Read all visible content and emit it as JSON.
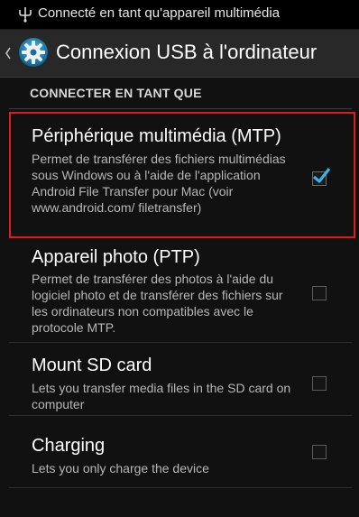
{
  "status_bar": {
    "icon": "usb-icon",
    "text": "Connecté en tant qu'appareil multimédia"
  },
  "action_bar": {
    "up_icon": "chevron-left-icon",
    "app_icon": "settings-gear-icon",
    "title": "Connexion USB à l'ordinateur"
  },
  "section": {
    "header": "CONNECTER EN TANT QUE"
  },
  "options": [
    {
      "title": "Périphérique multimédia (MTP)",
      "summary": "Permet de transférer des fichiers multimédias sous Windows ou à l'aide de l'application Android File Transfer pour Mac (voir www.android.com/ filetransfer)",
      "checked": true
    },
    {
      "title": "Appareil photo (PTP)",
      "summary": "Permet de transférer des photos à l'aide du logiciel photo et de transférer des fichiers sur les ordinateurs non compatibles avec le protocole MTP.",
      "checked": false
    },
    {
      "title": "Mount SD card",
      "summary": "Lets you transfer media files in the SD card on computer",
      "checked": false
    },
    {
      "title": "Charging",
      "summary": "Lets you only charge the device",
      "checked": false
    }
  ],
  "colors": {
    "highlight": "#e11a1a",
    "check_accent": "#33b5e5"
  }
}
